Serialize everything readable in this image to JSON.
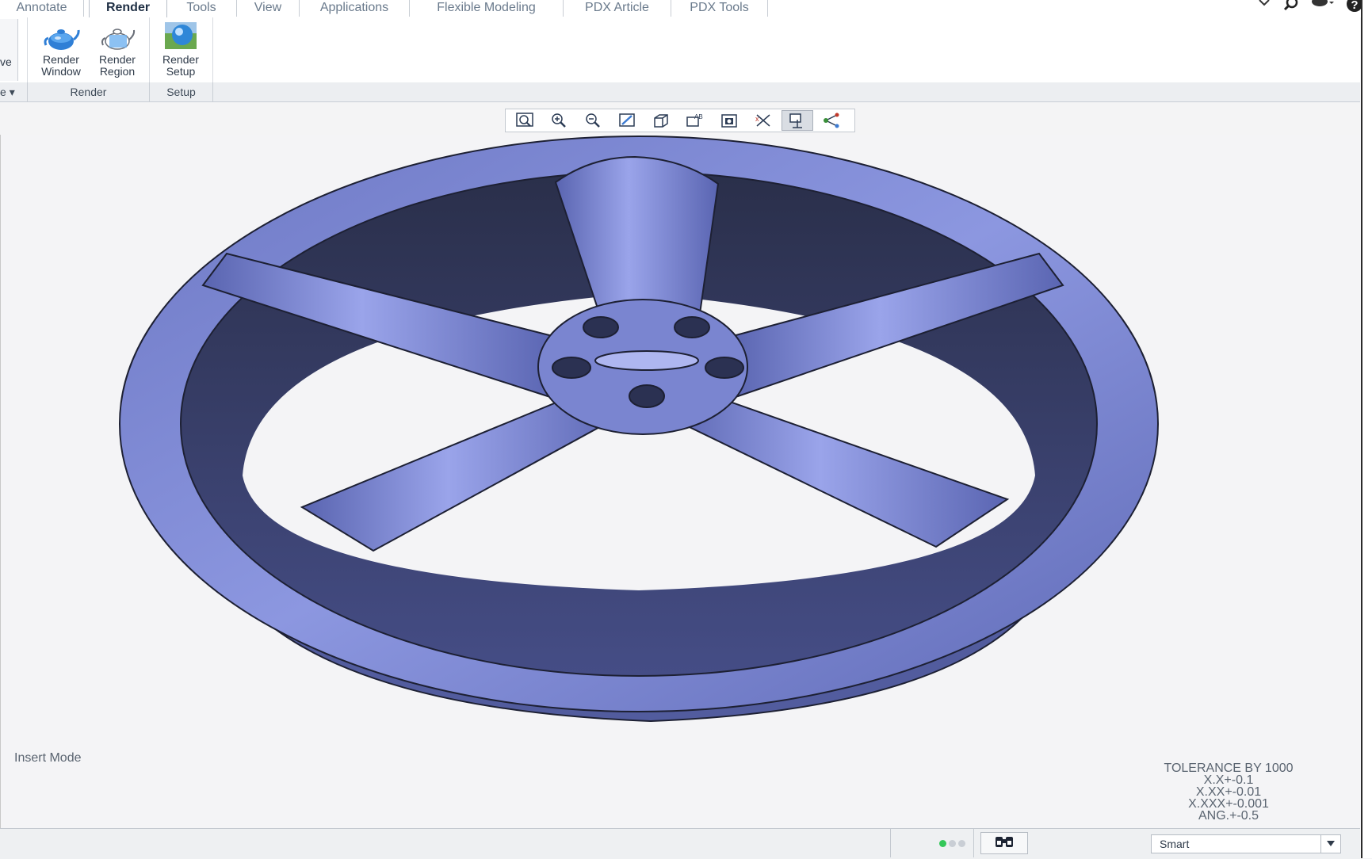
{
  "tabs": [
    {
      "label": "Annotate"
    },
    {
      "label": "Render"
    },
    {
      "label": "Tools"
    },
    {
      "label": "View"
    },
    {
      "label": "Applications"
    },
    {
      "label": "Flexible Modeling"
    },
    {
      "label": "PDX Article"
    },
    {
      "label": "PDX Tools"
    }
  ],
  "active_tab": "Render",
  "ribbon": {
    "partial_left_label": "ve",
    "partial_left_group": "e",
    "buttons": [
      {
        "label": "Render\nWindow",
        "icon": "teapot-icon"
      },
      {
        "label": "Render\nRegion",
        "icon": "teapot-region-icon"
      },
      {
        "label": "Render\nSetup",
        "icon": "render-sphere-icon"
      }
    ],
    "groups": [
      "Render",
      "Setup"
    ]
  },
  "view_toolbar": {
    "icons": [
      "refit-icon",
      "zoom-in-icon",
      "zoom-out-icon",
      "repaint-icon",
      "display-style-icon",
      "saved-orientations-icon",
      "view-manager-icon",
      "annotation-display-icon",
      "datum-display-icon",
      "spin-center-icon"
    ],
    "active_index": 8
  },
  "viewport": {
    "mode_text": "Insert Mode",
    "tolerance": [
      "TOLERANCE BY 1000",
      "X.X+-0.1",
      "X.XX+-0.01",
      "X.XXX+-0.001",
      "ANG.+-0.5"
    ],
    "model": "5-spoke wheel rim",
    "model_color": "#7f8ad4"
  },
  "status": {
    "filter_value": "Smart",
    "dots": [
      "#34c759",
      "#c9ced5",
      "#c9ced5"
    ]
  }
}
